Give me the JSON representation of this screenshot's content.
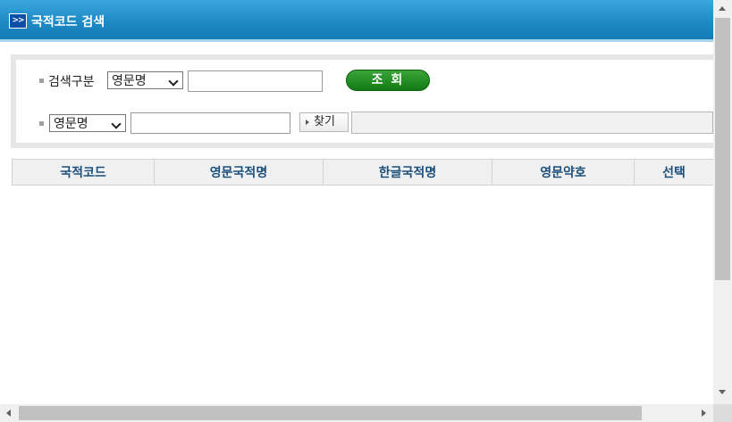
{
  "window": {
    "title": "국적코드 검색",
    "title_icon_text": ">>"
  },
  "search": {
    "category_label": "검색구분",
    "category_select_value": "영문명",
    "query_button_label": "조 회",
    "filter_select_value": "영문명",
    "find_button_label": "찾기"
  },
  "table": {
    "columns": [
      "국적코드",
      "영문국적명",
      "한글국적명",
      "영문약호",
      "선택"
    ],
    "rows": []
  },
  "colors": {
    "title_bar": "#1e8bc6",
    "query_button": "#137a13",
    "header_text": "#1b4f7c"
  },
  "icons": {
    "title_icon": "double-chevron-right-icon",
    "find_icon": "triangle-right-icon"
  }
}
